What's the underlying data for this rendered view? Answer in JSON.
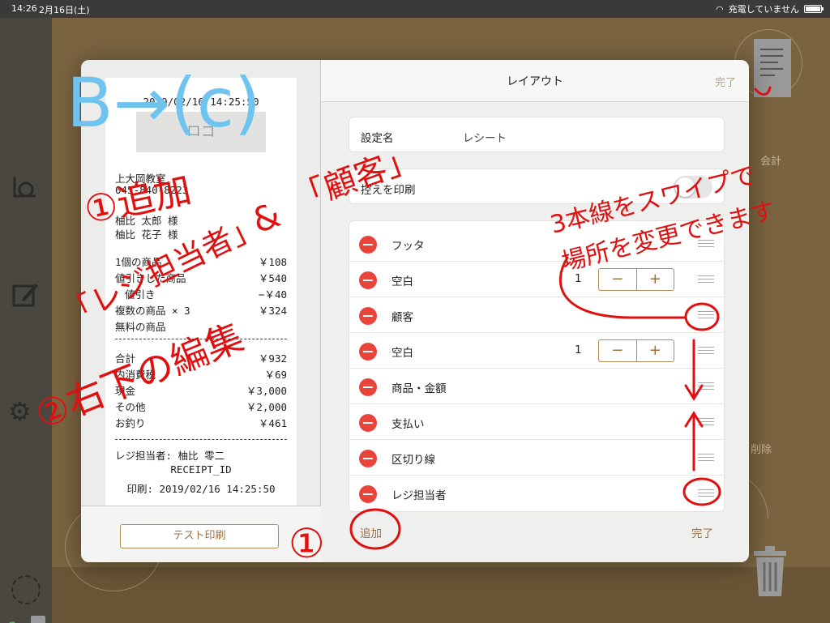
{
  "status_bar": {
    "time": "14:26",
    "date": "2月16日(土)",
    "charging": "充電していません"
  },
  "background": {
    "sales_label": "会計",
    "delete_label": "削除"
  },
  "receipt_preview": {
    "date": "2019/02/16 14:25:50",
    "logo": "ロゴ",
    "store_name": "上大岡教室",
    "phone": "045-840-8223",
    "customers": [
      "柚比 太郎 様",
      "柚比 花子 様"
    ],
    "items": [
      {
        "name": "1個の商品",
        "price": "￥108"
      },
      {
        "name": "値引きした商品",
        "price": "￥540"
      },
      {
        "name": "値引き",
        "price": "−￥40"
      },
      {
        "name": "複数の商品 × 3",
        "price": "￥324"
      },
      {
        "name": "無料の商品",
        "price": ""
      }
    ],
    "totals": [
      {
        "name": "合計",
        "price": "￥932"
      },
      {
        "name": "内消費税",
        "price": "￥69"
      },
      {
        "name": "現金",
        "price": "￥3,000"
      },
      {
        "name": "その他",
        "price": "￥2,000"
      },
      {
        "name": "お釣り",
        "price": "￥461"
      }
    ],
    "staff": "レジ担当者: 柚比 零二",
    "receipt_id": "RECEIPT_ID",
    "printed": "印刷: 2019/02/16 14:25:50",
    "test_print_button": "テスト印刷"
  },
  "layout_panel": {
    "title": "レイアウト",
    "done_header": "完了",
    "setting_name_label": "設定名",
    "setting_name_value": "レシート",
    "copy_print_label": "控えを印刷",
    "rows": [
      {
        "label": "フッタ"
      },
      {
        "label": "空白",
        "count": "1"
      },
      {
        "label": "顧客"
      },
      {
        "label": "空白",
        "count": "1"
      },
      {
        "label": "商品・金額"
      },
      {
        "label": "支払い"
      },
      {
        "label": "区切り線"
      },
      {
        "label": "レジ担当者"
      }
    ],
    "stepper_minus": "−",
    "stepper_plus": "+",
    "add_label": "追加",
    "done_footer": "完了"
  },
  "annotations": {
    "heading": "B→(c)",
    "note_1": "①追加",
    "note_staff": "「レジ担当者」",
    "note_and": "&",
    "note_customer": "「顧客」",
    "note_2": "②右下の編集",
    "note_circle": "①",
    "note_swipe_1": "3本線をスワイプで",
    "note_swipe_2": "場所を変更できます"
  },
  "colors": {
    "accent": "#9a7040",
    "delete": "#e8443a",
    "annotation_red": "#e01010",
    "annotation_blue": "#6ec4ee"
  }
}
